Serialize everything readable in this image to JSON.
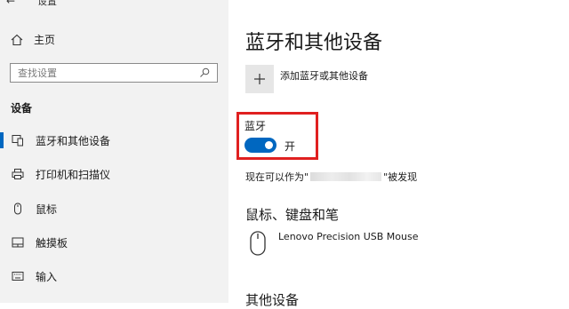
{
  "sidebar": {
    "window_title": "设置",
    "home_label": "主页",
    "search_placeholder": "查找设置",
    "section_label": "设备",
    "items": [
      {
        "label": "蓝牙和其他设备",
        "icon": "bluetooth-devices-icon",
        "active": true
      },
      {
        "label": "打印机和扫描仪",
        "icon": "printer-icon",
        "active": false
      },
      {
        "label": "鼠标",
        "icon": "mouse-icon",
        "active": false
      },
      {
        "label": "触摸板",
        "icon": "touchpad-icon",
        "active": false
      },
      {
        "label": "输入",
        "icon": "keyboard-icon",
        "active": false
      }
    ]
  },
  "main": {
    "title": "蓝牙和其他设备",
    "add_device_label": "添加蓝牙或其他设备",
    "bluetooth": {
      "label": "蓝牙",
      "state_text": "开",
      "on": true
    },
    "discoverable": {
      "prefix": "现在可以作为\"",
      "suffix": "\"被发现"
    },
    "mouse_section": {
      "title": "鼠标、键盘和笔",
      "device_name": "Lenovo Precision USB Mouse"
    },
    "other_section_title": "其他设备"
  },
  "colors": {
    "accent": "#0067c0",
    "highlight_border": "#e02020",
    "sidebar_bg": "#f2f2f2"
  }
}
